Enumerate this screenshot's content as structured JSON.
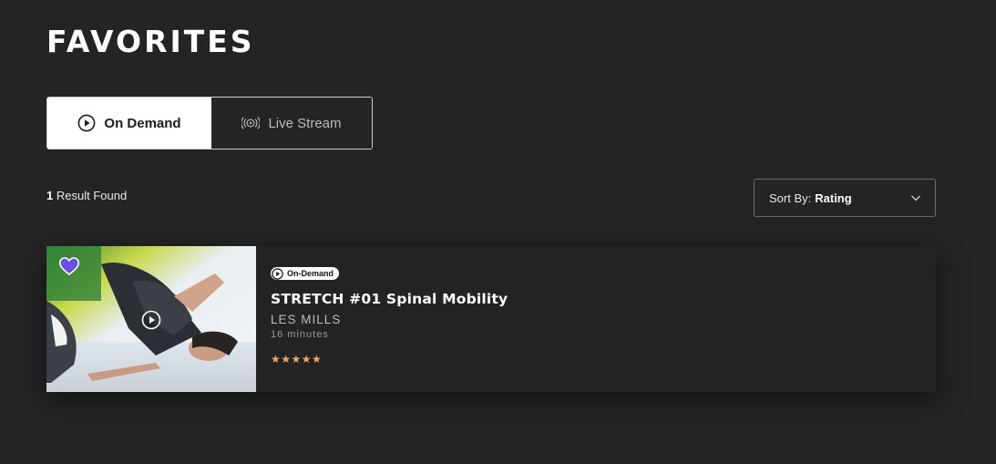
{
  "page": {
    "title": "FAVORITES"
  },
  "tabs": [
    {
      "label": "On Demand",
      "icon": "play-circle-icon",
      "active": true
    },
    {
      "label": "Live Stream",
      "icon": "broadcast-icon",
      "active": false
    }
  ],
  "results": {
    "count": "1",
    "text": "Result Found"
  },
  "sort": {
    "label": "Sort By:",
    "value": "Rating"
  },
  "card": {
    "badge": "On-Demand",
    "title": "STRETCH #01 Spinal Mobility",
    "artist": "LES MILLS",
    "duration": "16 minutes",
    "rating_text": "★★★★★",
    "rating": 5,
    "favorited": true,
    "thumbnail_icon": "play-circle-icon"
  },
  "colors": {
    "background": "#252424",
    "card_background": "#232323",
    "star": "#f2a96a",
    "heart": "#6a4fe0"
  }
}
